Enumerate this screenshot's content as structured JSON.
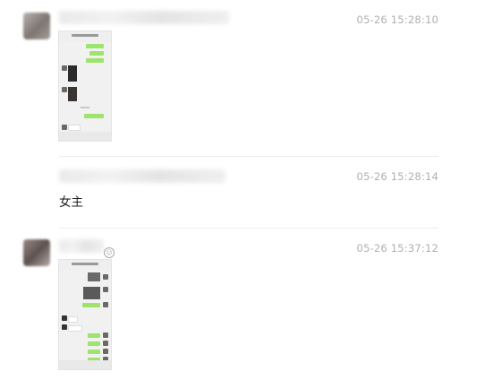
{
  "messages": [
    {
      "time": "05-26 15:28:10"
    },
    {
      "time": "05-26 15:28:14",
      "text": "女主"
    },
    {
      "time": "05-26 15:37:12"
    }
  ]
}
